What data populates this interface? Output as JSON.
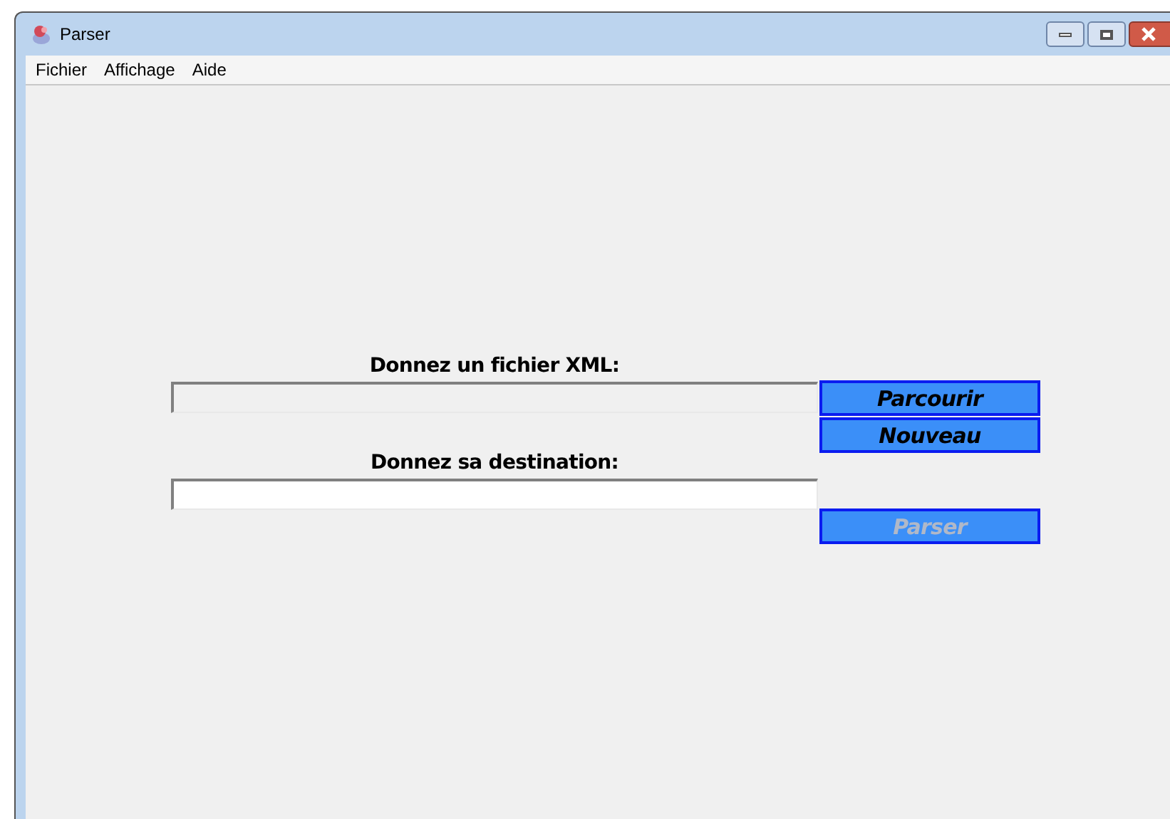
{
  "window": {
    "title": "Parser"
  },
  "menu": [
    {
      "label": "Fichier"
    },
    {
      "label": "Affichage"
    },
    {
      "label": "Aide"
    }
  ],
  "source": {
    "label": "Donnez un fichier XML:",
    "disabled": true
  },
  "browse_button": {
    "label": "Parcourir",
    "disabled": false
  },
  "new_button": {
    "label": "Nouveau",
    "disabled": false
  },
  "destination": {
    "label": "Donnez sa destination:",
    "disabled": false
  },
  "parse_button": {
    "label": "Parser",
    "disabled": true
  }
}
